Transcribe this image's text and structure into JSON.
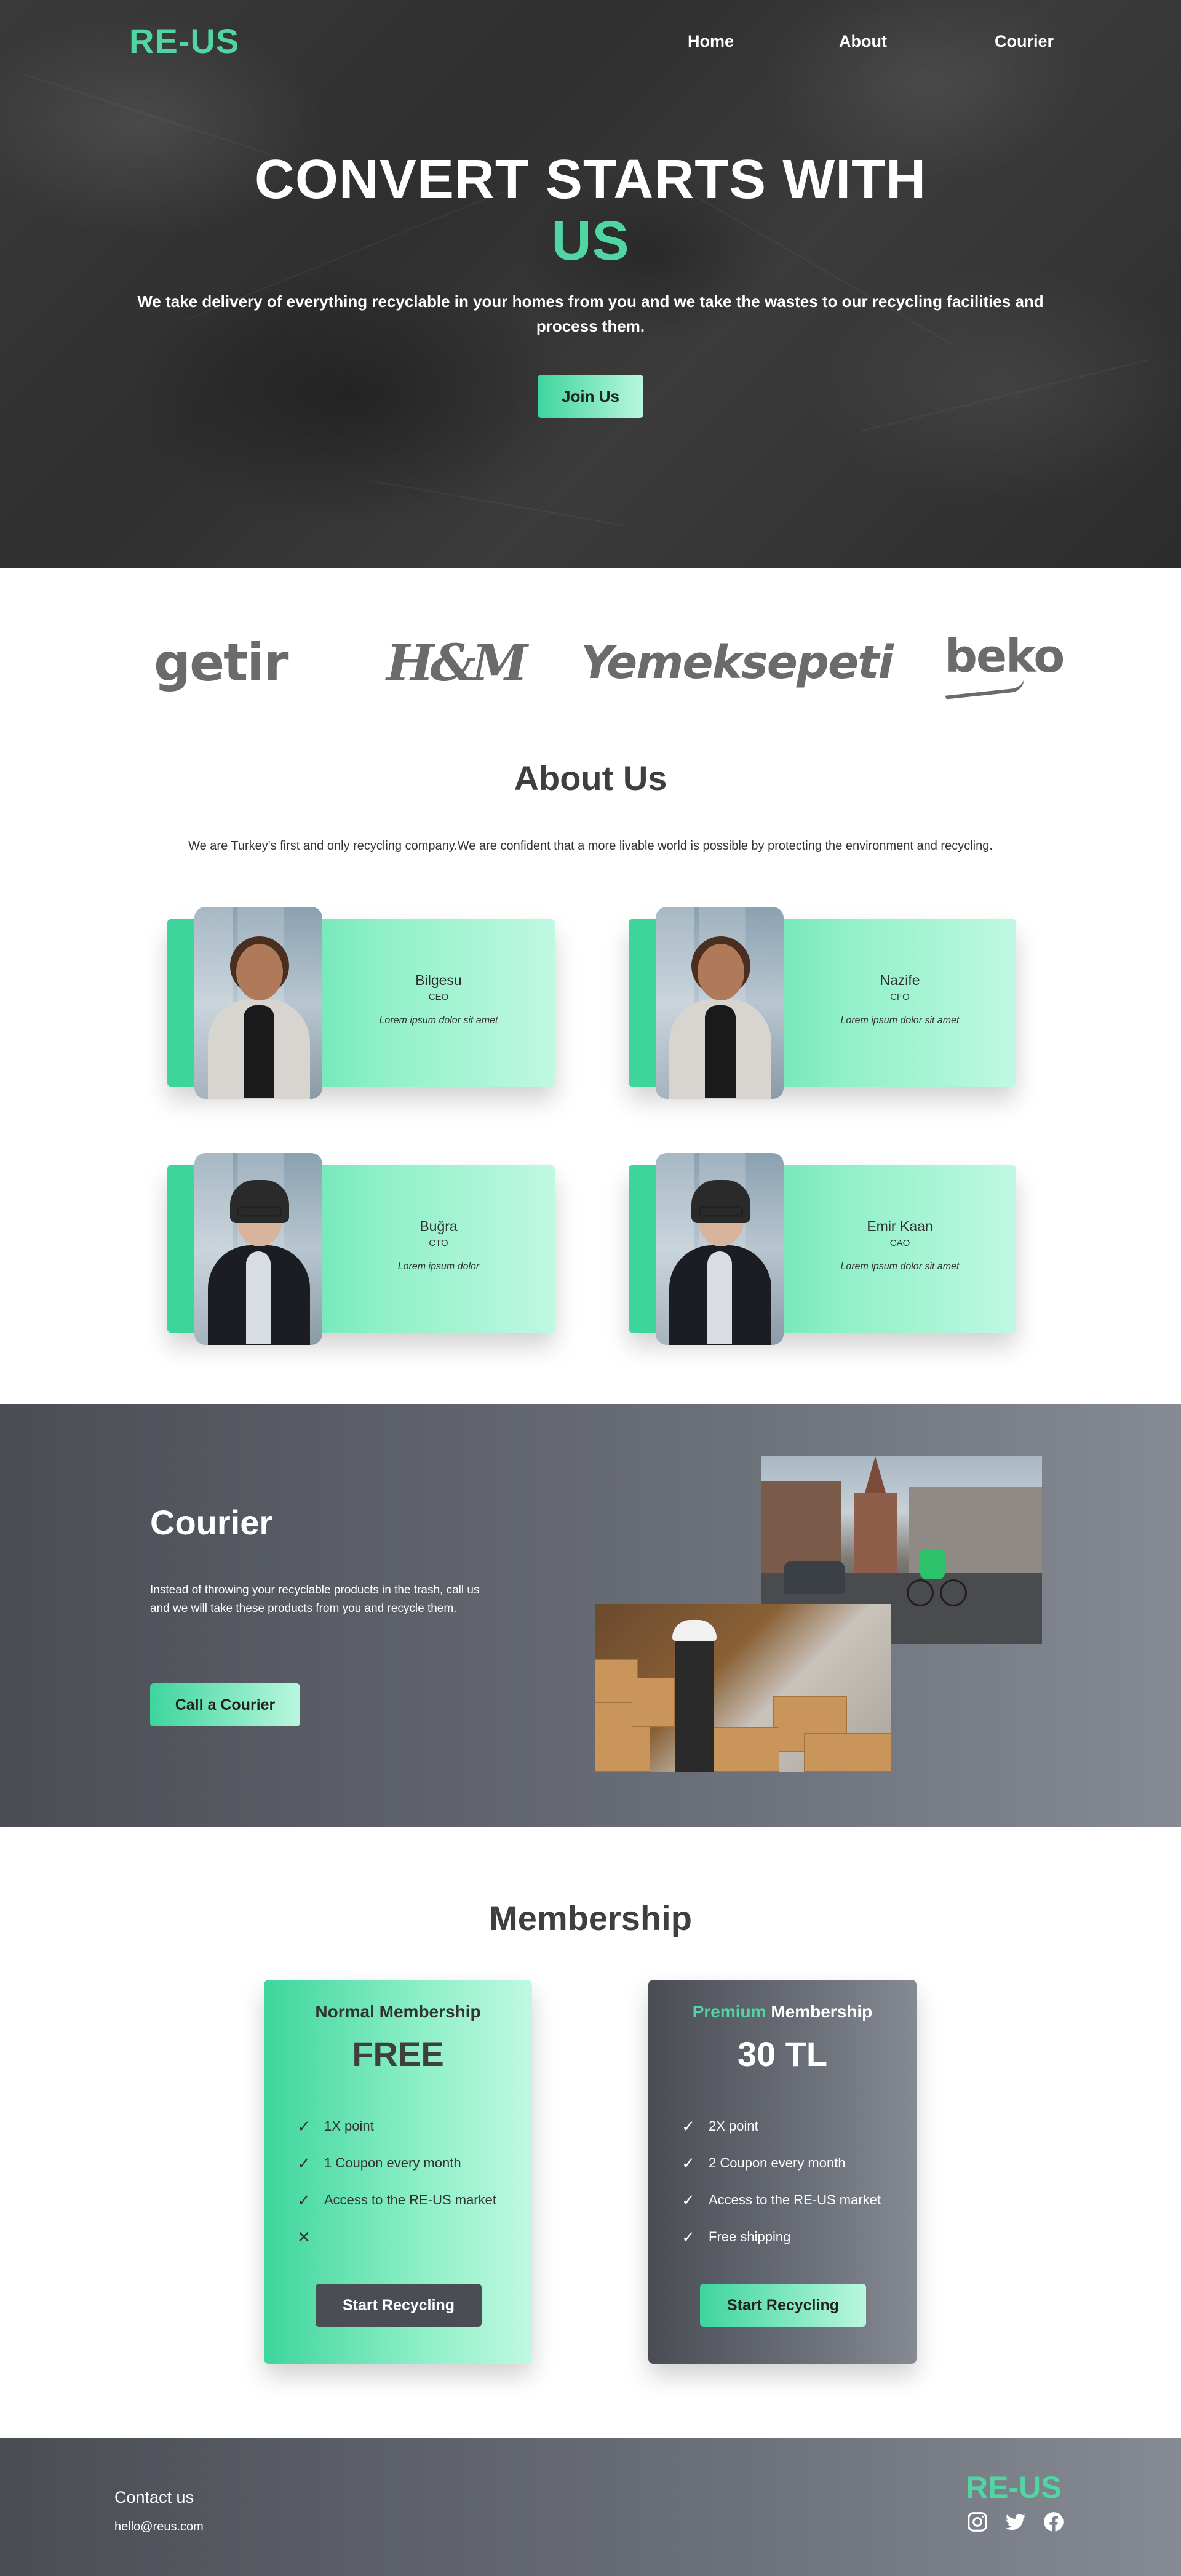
{
  "nav": {
    "logo": "RE-US",
    "links": [
      "Home",
      "About",
      "Courier"
    ]
  },
  "hero": {
    "title_main": "CONVERT STARTS WITH",
    "title_accent": "US",
    "subtitle": "We take delivery of everything recyclable in your homes from you and we take the wastes to our recycling facilities and process them.",
    "cta": "Join Us"
  },
  "brands": [
    "getir",
    "H&M",
    "Yemeksepeti",
    "beko"
  ],
  "about": {
    "title": "About Us",
    "text": "We are Turkey's first and only recycling company.We are confident that a more livable world is possible by protecting the environment and recycling.",
    "members": [
      {
        "name": "Bilgesu",
        "role": "CEO",
        "desc": "Lorem ipsum dolor sit amet"
      },
      {
        "name": "Nazife",
        "role": "CFO",
        "desc": "Lorem ipsum dolor sit amet"
      },
      {
        "name": "Buğra",
        "role": "CTO",
        "desc": "Lorem ipsum dolor"
      },
      {
        "name": "Emir Kaan",
        "role": "CAO",
        "desc": "Lorem ipsum dolor sit amet"
      }
    ]
  },
  "courier": {
    "title": "Courier",
    "text": "Instead of throwing your recyclable products in the trash, call us and we will take these products from you and recycle them.",
    "cta": "Call a Courier"
  },
  "membership": {
    "title": "Membership",
    "plans": [
      {
        "name_prefix": "",
        "name": "Normal Membership",
        "price": "FREE",
        "features": [
          {
            "icon": "check-icon",
            "text": "1X point"
          },
          {
            "icon": "check-icon",
            "text": "1 Coupon every month"
          },
          {
            "icon": "check-icon",
            "text": "Access to the RE-US market"
          },
          {
            "icon": "cross-icon",
            "text": ""
          }
        ],
        "cta": "Start Recycling"
      },
      {
        "name_prefix": "Premium",
        "name": "Membership",
        "price": "30 TL",
        "features": [
          {
            "icon": "check-icon",
            "text": "2X point"
          },
          {
            "icon": "check-icon",
            "text": "2 Coupon every month"
          },
          {
            "icon": "check-icon",
            "text": "Access to the RE-US market"
          },
          {
            "icon": "check-icon",
            "text": "Free shipping"
          }
        ],
        "cta": "Start Recycling"
      }
    ]
  },
  "footer": {
    "contact_label": "Contact us",
    "email": "hello@reus.com",
    "logo": "RE-US",
    "social": [
      "instagram-icon",
      "twitter-icon",
      "facebook-icon"
    ]
  },
  "colors": {
    "accent": "#4fd6a3",
    "accent_gradient_start": "#3ed59d",
    "accent_gradient_end": "#c0f8e2",
    "dark": "#4a4d54",
    "hero_bg": "#333333"
  }
}
